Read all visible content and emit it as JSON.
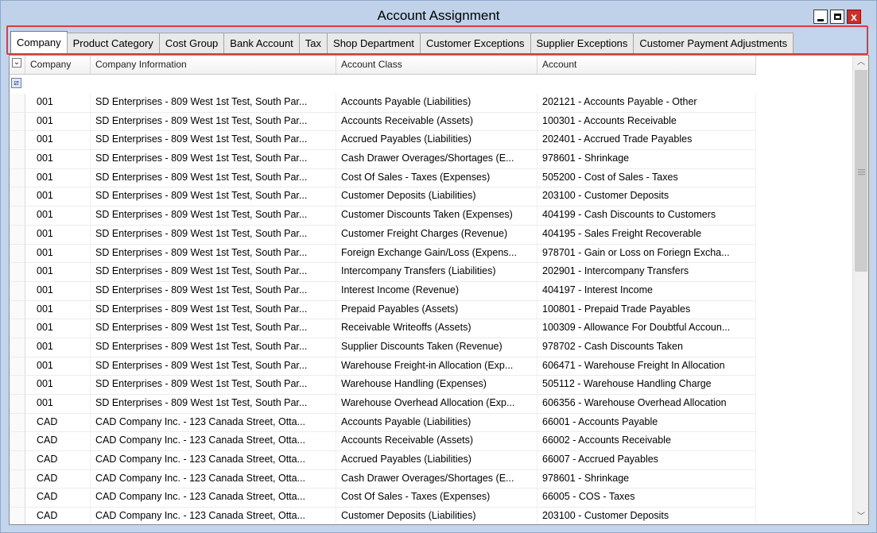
{
  "window": {
    "title": "Account Assignment",
    "close_label": "x"
  },
  "tabs": [
    {
      "label": "Company",
      "active": true
    },
    {
      "label": "Product Category"
    },
    {
      "label": "Cost Group"
    },
    {
      "label": "Bank Account"
    },
    {
      "label": "Tax"
    },
    {
      "label": "Shop Department"
    },
    {
      "label": "Customer Exceptions"
    },
    {
      "label": "Supplier Exceptions"
    },
    {
      "label": "Customer Payment Adjustments"
    }
  ],
  "grid": {
    "columns": [
      "Company",
      "Company Information",
      "Account Class",
      "Account"
    ],
    "rows": [
      [
        "001",
        "SD Enterprises - 809 West 1st Test, South Par...",
        "Accounts Payable (Liabilities)",
        "202121 - Accounts Payable - Other"
      ],
      [
        "001",
        "SD Enterprises - 809 West 1st Test, South Par...",
        "Accounts Receivable (Assets)",
        "100301 - Accounts Receivable"
      ],
      [
        "001",
        "SD Enterprises - 809 West 1st Test, South Par...",
        "Accrued Payables (Liabilities)",
        "202401 - Accrued Trade Payables"
      ],
      [
        "001",
        "SD Enterprises - 809 West 1st Test, South Par...",
        "Cash Drawer Overages/Shortages (E...",
        "978601 - Shrinkage"
      ],
      [
        "001",
        "SD Enterprises - 809 West 1st Test, South Par...",
        "Cost Of Sales - Taxes (Expenses)",
        "505200 - Cost of Sales - Taxes"
      ],
      [
        "001",
        "SD Enterprises - 809 West 1st Test, South Par...",
        "Customer Deposits (Liabilities)",
        "203100 - Customer Deposits"
      ],
      [
        "001",
        "SD Enterprises - 809 West 1st Test, South Par...",
        "Customer Discounts Taken (Expenses)",
        "404199 - Cash Discounts to Customers"
      ],
      [
        "001",
        "SD Enterprises - 809 West 1st Test, South Par...",
        "Customer Freight Charges (Revenue)",
        "404195 - Sales Freight Recoverable"
      ],
      [
        "001",
        "SD Enterprises - 809 West 1st Test, South Par...",
        "Foreign Exchange Gain/Loss (Expens...",
        "978701 - Gain or Loss on Foriegn Excha..."
      ],
      [
        "001",
        "SD Enterprises - 809 West 1st Test, South Par...",
        "Intercompany Transfers (Liabilities)",
        "202901 - Intercompany Transfers"
      ],
      [
        "001",
        "SD Enterprises - 809 West 1st Test, South Par...",
        "Interest Income (Revenue)",
        "404197 - Interest Income"
      ],
      [
        "001",
        "SD Enterprises - 809 West 1st Test, South Par...",
        "Prepaid Payables (Assets)",
        "100801 - Prepaid Trade Payables"
      ],
      [
        "001",
        "SD Enterprises - 809 West 1st Test, South Par...",
        "Receivable Writeoffs (Assets)",
        "100309 - Allowance For Doubtful Accoun..."
      ],
      [
        "001",
        "SD Enterprises - 809 West 1st Test, South Par...",
        "Supplier Discounts Taken (Revenue)",
        "978702 - Cash Discounts Taken"
      ],
      [
        "001",
        "SD Enterprises - 809 West 1st Test, South Par...",
        "Warehouse Freight-in Allocation (Exp...",
        "606471 - Warehouse Freight In Allocation"
      ],
      [
        "001",
        "SD Enterprises - 809 West 1st Test, South Par...",
        "Warehouse Handling (Expenses)",
        "505112 - Warehouse Handling Charge"
      ],
      [
        "001",
        "SD Enterprises - 809 West 1st Test, South Par...",
        "Warehouse Overhead Allocation (Exp...",
        "606356 - Warehouse Overhead Allocation"
      ],
      [
        "CAD",
        "CAD Company Inc. - 123 Canada Street, Otta...",
        "Accounts Payable (Liabilities)",
        "66001 - Accounts Payable"
      ],
      [
        "CAD",
        "CAD Company Inc. - 123 Canada Street, Otta...",
        "Accounts Receivable (Assets)",
        "66002 - Accounts Receivable"
      ],
      [
        "CAD",
        "CAD Company Inc. - 123 Canada Street, Otta...",
        "Accrued Payables (Liabilities)",
        "66007 - Accrued Payables"
      ],
      [
        "CAD",
        "CAD Company Inc. - 123 Canada Street, Otta...",
        "Cash Drawer Overages/Shortages (E...",
        "978601 - Shrinkage"
      ],
      [
        "CAD",
        "CAD Company Inc. - 123 Canada Street, Otta...",
        "Cost Of Sales - Taxes (Expenses)",
        "66005 - COS - Taxes"
      ],
      [
        "CAD",
        "CAD Company Inc. - 123 Canada Street, Otta...",
        "Customer Deposits (Liabilities)",
        "203100 - Customer Deposits"
      ]
    ]
  },
  "icons": {
    "minimize": "minimize-icon",
    "maximize": "maximize-icon",
    "close": "close-icon",
    "filter": "filter-icon",
    "column_chooser": "column-chooser-icon"
  },
  "colors": {
    "highlight": "#e03b3b",
    "title_bg": "#bfd2ea",
    "close_bg": "#c8302a"
  }
}
